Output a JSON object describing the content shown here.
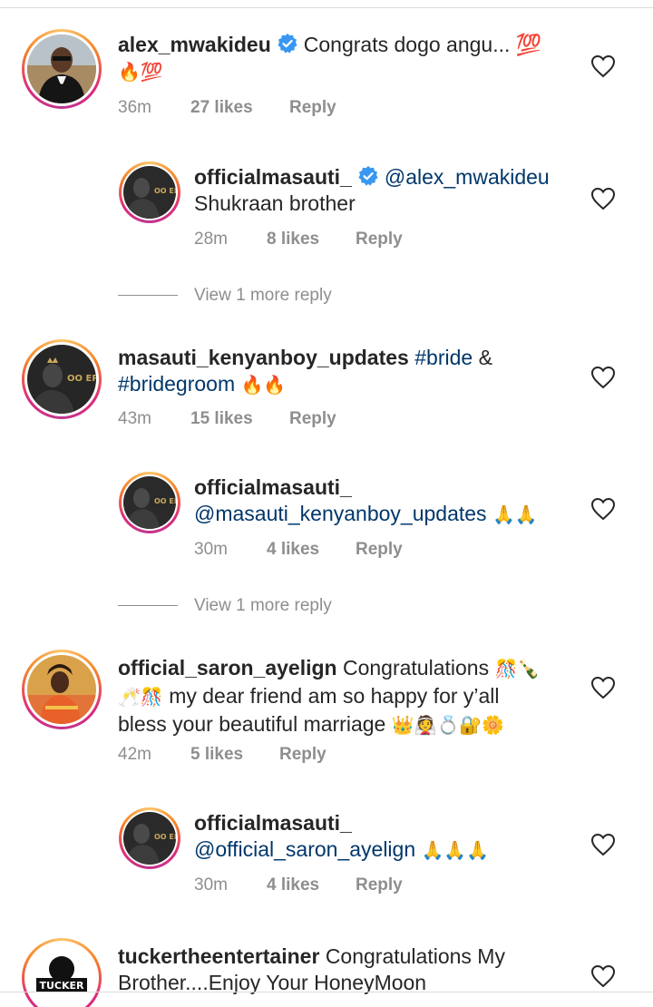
{
  "comments": [
    {
      "username": "alex_mwakideu",
      "verified": true,
      "text": "Congrats dogo angu... 💯",
      "text2": "🔥💯",
      "time": "36m",
      "likes": "27 likes",
      "reply": "Reply"
    },
    {
      "username": "officialmasauti_",
      "verified": true,
      "mention": "@alex_mwakideu",
      "text": "Shukraan brother",
      "time": "28m",
      "likes": "8 likes",
      "reply": "Reply",
      "view_more": "View 1 more reply"
    },
    {
      "username": "masauti_kenyanboy_updates",
      "tag1": "#bride",
      "amp": "&",
      "tag2": "#bridegroom",
      "emoji": "🔥🔥",
      "time": "43m",
      "likes": "15 likes",
      "reply": "Reply"
    },
    {
      "username": "officialmasauti_",
      "mention": "@masauti_kenyanboy_updates",
      "emoji": "🙏🙏",
      "time": "30m",
      "likes": "4 likes",
      "reply": "Reply",
      "view_more": "View 1 more reply"
    },
    {
      "username": "official_saron_ayelign",
      "text": "Congratulations",
      "emoji1": "🎊🍾",
      "line2_emoji": "🥂🎊",
      "line2_text": "my dear friend am so happy for y’all",
      "line3_text": "bless your beautiful marriage",
      "line3_emoji": "👑👰💍🔐🌼",
      "time": "42m",
      "likes": "5 likes",
      "reply": "Reply"
    },
    {
      "username": "officialmasauti_",
      "mention": "@official_saron_ayelign",
      "emoji": "🙏🙏🙏",
      "time": "30m",
      "likes": "4 likes",
      "reply": "Reply"
    },
    {
      "username": "tuckertheentertainer",
      "text": "Congratulations My",
      "text2": "Brother....Enjoy Your HoneyMoon"
    }
  ],
  "colors": {
    "verified": "#3897f0",
    "hashtag": "#00376b",
    "meta": "#8e8e8e"
  },
  "icons": {
    "like": "heart-outline-icon",
    "verified": "verified-badge-icon"
  }
}
